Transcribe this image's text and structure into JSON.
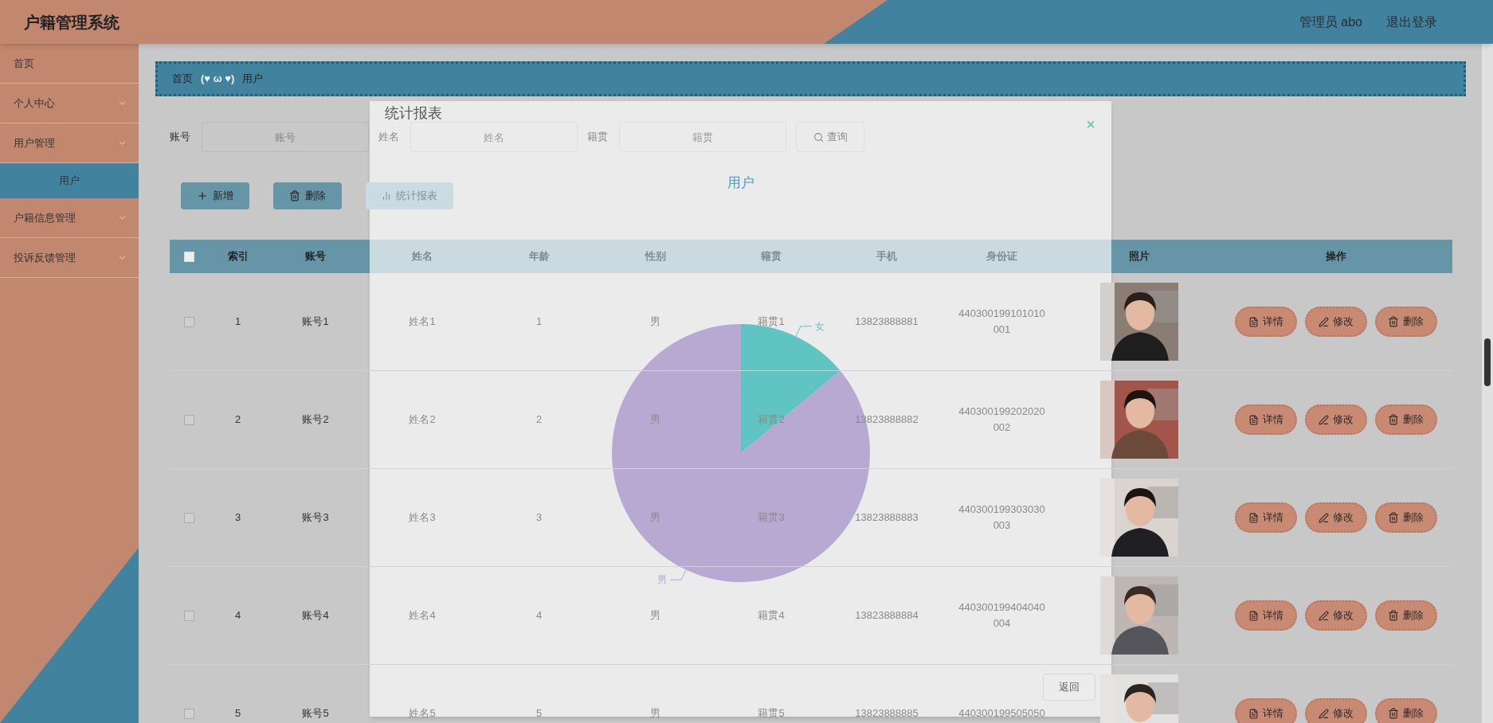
{
  "header": {
    "title": "户籍管理系统",
    "user": "管理员 abo",
    "logout": "退出登录"
  },
  "sidebar": {
    "items": [
      {
        "label": "首页",
        "has_children": false,
        "selected": false
      },
      {
        "label": "个人中心",
        "has_children": true,
        "selected": false
      },
      {
        "label": "用户管理",
        "has_children": true,
        "selected": false,
        "children": [
          {
            "label": "用户",
            "selected": true
          }
        ]
      },
      {
        "label": "户籍信息管理",
        "has_children": true,
        "selected": false
      },
      {
        "label": "投诉反馈管理",
        "has_children": true,
        "selected": false
      }
    ]
  },
  "breadcrumb": [
    "首页",
    "(♥ ω ♥)",
    "用户"
  ],
  "search": [
    {
      "label": "账号",
      "placeholder": "账号"
    },
    {
      "label": "姓名",
      "placeholder": "姓名"
    },
    {
      "label": "籍贯",
      "placeholder": "籍贯"
    }
  ],
  "search_button": "查询",
  "actions": [
    {
      "kind": "add",
      "label": "新增"
    },
    {
      "kind": "delete",
      "label": "删除"
    },
    {
      "kind": "chart",
      "label": "统计报表"
    }
  ],
  "table": {
    "select_all_checked": false,
    "columns": [
      "索引",
      "账号",
      "姓名",
      "年龄",
      "性别",
      "籍贯",
      "手机",
      "身份证",
      "照片",
      "操作"
    ],
    "rows": [
      {
        "checked": false,
        "cells": [
          "1",
          "账号1",
          "姓名1",
          "1",
          "男",
          "籍贯1",
          "13823888881",
          "440300199101010001"
        ],
        "actions": [
          {
            "kind": "detail",
            "label": "详情"
          },
          {
            "kind": "edit",
            "label": "修改"
          },
          {
            "kind": "delete",
            "label": "删除"
          }
        ]
      },
      {
        "checked": false,
        "cells": [
          "2",
          "账号2",
          "姓名2",
          "2",
          "男",
          "籍贯2",
          "13823888882",
          "440300199202020002"
        ],
        "actions": [
          {
            "kind": "detail",
            "label": "详情"
          },
          {
            "kind": "edit",
            "label": "修改"
          },
          {
            "kind": "delete",
            "label": "删除"
          }
        ]
      },
      {
        "checked": false,
        "cells": [
          "3",
          "账号3",
          "姓名3",
          "3",
          "男",
          "籍贯3",
          "13823888883",
          "440300199303030003"
        ],
        "actions": [
          {
            "kind": "detail",
            "label": "详情"
          },
          {
            "kind": "edit",
            "label": "修改"
          },
          {
            "kind": "delete",
            "label": "删除"
          }
        ]
      },
      {
        "checked": false,
        "cells": [
          "4",
          "账号4",
          "姓名4",
          "4",
          "男",
          "籍贯4",
          "13823888884",
          "440300199404040004"
        ],
        "actions": [
          {
            "kind": "detail",
            "label": "详情"
          },
          {
            "kind": "edit",
            "label": "修改"
          },
          {
            "kind": "delete",
            "label": "删除"
          }
        ]
      },
      {
        "checked": false,
        "cells": [
          "5",
          "账号5",
          "姓名5",
          "5",
          "男",
          "籍贯5",
          "13823888885",
          "440300199505050"
        ],
        "actions": [
          {
            "kind": "detail",
            "label": "详情"
          },
          {
            "kind": "edit",
            "label": "修改"
          },
          {
            "kind": "delete",
            "label": "删除"
          }
        ]
      }
    ]
  },
  "dialog": {
    "title": "统计报表",
    "close": "×",
    "back_button": "返回",
    "chart_data": {
      "type": "pie",
      "title": "用户",
      "categories": [
        "女",
        "男"
      ],
      "values": [
        14,
        86
      ],
      "colors": [
        "#5fc4c2",
        "#b8a9d2"
      ]
    }
  }
}
